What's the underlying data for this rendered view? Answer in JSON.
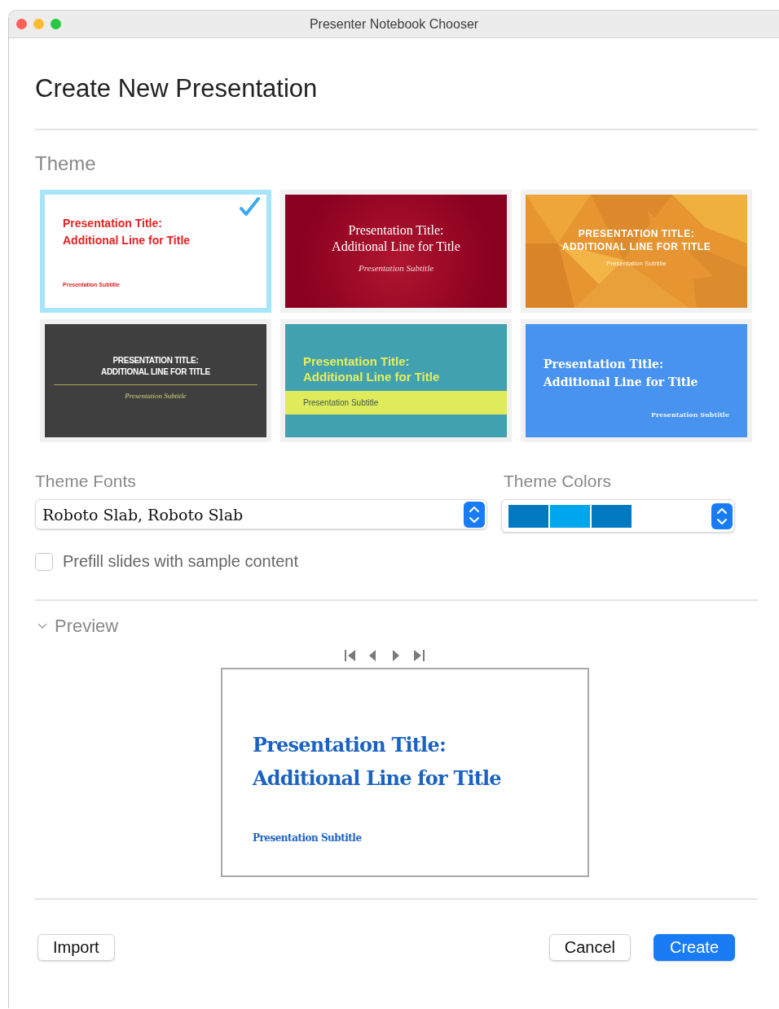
{
  "window": {
    "title": "Presenter Notebook Chooser"
  },
  "heading": "Create New Presentation",
  "theme_section": {
    "label": "Theme"
  },
  "themes": [
    {
      "kind": "white-red",
      "selected": true,
      "title_lines": [
        "Presentation Title:",
        "Additional Line for Title"
      ],
      "subtitle": "Presentation Subtitle"
    },
    {
      "kind": "crimson",
      "selected": false,
      "title_lines": [
        "Presentation Title:",
        "Additional Line for Title"
      ],
      "subtitle": "Presentation Subtitle"
    },
    {
      "kind": "orange",
      "selected": false,
      "title_lines": [
        "PRESENTATION TITLE:",
        "ADDITIONAL LINE FOR TITLE"
      ],
      "subtitle": "Presentation Subtitle"
    },
    {
      "kind": "dark",
      "selected": false,
      "title_lines": [
        "PRESENTATION TITLE:",
        "ADDITIONAL LINE FOR TITLE"
      ],
      "subtitle": "Presentation Subtitle"
    },
    {
      "kind": "teal",
      "selected": false,
      "title_lines": [
        "Presentation Title:",
        "Additional Line for Title"
      ],
      "subtitle": "Presentation Subtitle"
    },
    {
      "kind": "blue",
      "selected": false,
      "title_lines": [
        "Presentation Title:",
        "Additional Line for Title"
      ],
      "subtitle": "Presentation Subtitle"
    }
  ],
  "theme_fonts": {
    "label": "Theme Fonts",
    "value": "Roboto Slab, Roboto Slab"
  },
  "theme_colors": {
    "label": "Theme Colors",
    "swatches": [
      {
        "color": "#0079c1"
      },
      {
        "color": "#00a6ed"
      },
      {
        "color": "#0079c1"
      }
    ]
  },
  "prefill": {
    "label": "Prefill slides with sample content",
    "checked": false
  },
  "preview": {
    "label": "Preview",
    "expanded": true,
    "title_lines": [
      "Presentation Title:",
      "Additional Line for Title"
    ],
    "subtitle": "Presentation Subtitle"
  },
  "buttons": {
    "import": "Import",
    "cancel": "Cancel",
    "create": "Create"
  }
}
